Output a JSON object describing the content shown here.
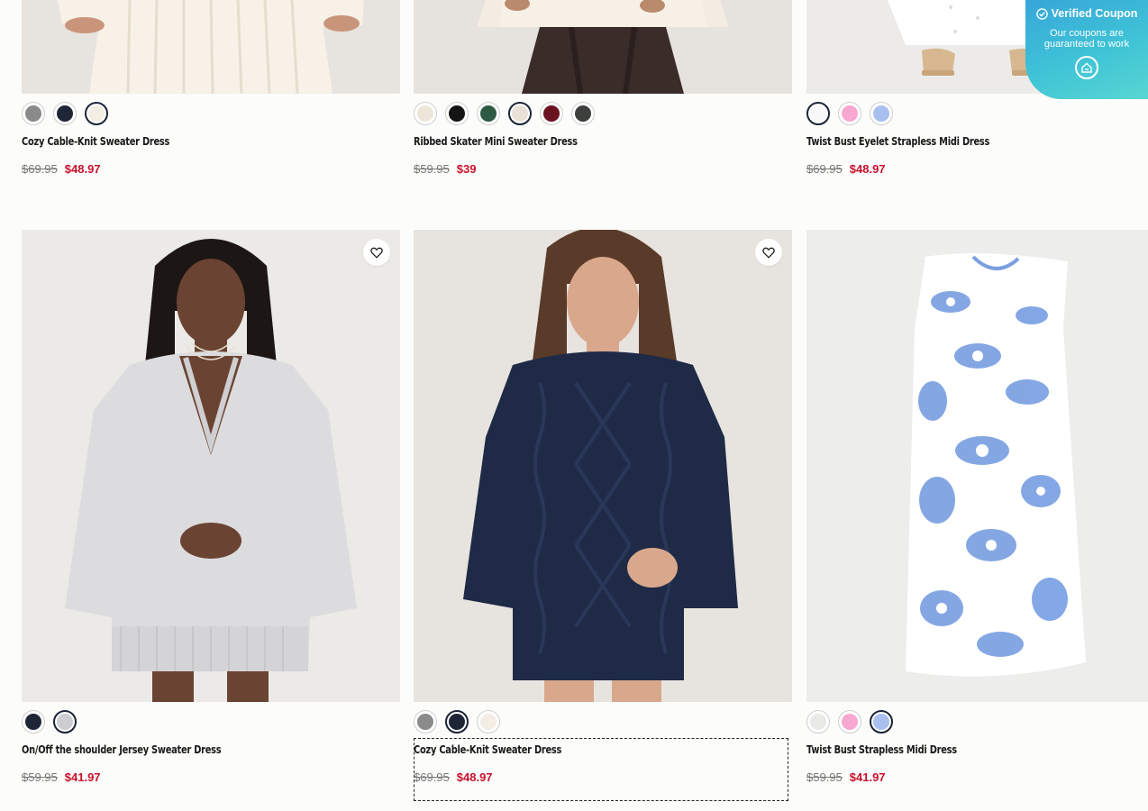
{
  "coupon": {
    "title": "Verified Coupon",
    "subtitle": "Our coupons are guaranteed to work"
  },
  "products": [
    {
      "name": "Cozy Cable-Knit Sweater Dress",
      "original_price": "$69.95",
      "sale_price": "$48.97",
      "swatches": [
        "#8a8a8a",
        "#1e2536",
        "#f3ede4"
      ],
      "selected_swatch": 2
    },
    {
      "name": "Ribbed Skater Mini Sweater Dress",
      "original_price": "$59.95",
      "sale_price": "$39",
      "swatches": [
        "#ede6d8",
        "#151515",
        "#2e5a44",
        "#e9e1d6",
        "#6b1220",
        "#3c3f3c"
      ],
      "selected_swatch": 3
    },
    {
      "name": "Twist Bust Eyelet Strapless Midi Dress",
      "original_price": "$69.95",
      "sale_price": "$48.97",
      "swatches": [
        "#f8f8f8",
        "#f6a8d0",
        "#a9bff0"
      ],
      "selected_swatch": 0
    },
    {
      "name": "On/Off the shoulder Jersey Sweater Dress",
      "original_price": "$59.95",
      "sale_price": "$41.97",
      "swatches": [
        "#1e2536",
        "#cdcdd1"
      ],
      "selected_swatch": 1
    },
    {
      "name": "Cozy Cable-Knit Sweater Dress",
      "original_price": "$69.95",
      "sale_price": "$48.97",
      "swatches": [
        "#8a8a8a",
        "#1e2536",
        "#f3ede4"
      ],
      "selected_swatch": 1
    },
    {
      "name": "Twist Bust Strapless Midi Dress",
      "original_price": "$59.95",
      "sale_price": "$41.97",
      "swatches": [
        "#e9e9e7",
        "#f6a8d0",
        "#a9bff0"
      ],
      "selected_swatch": 2
    }
  ]
}
